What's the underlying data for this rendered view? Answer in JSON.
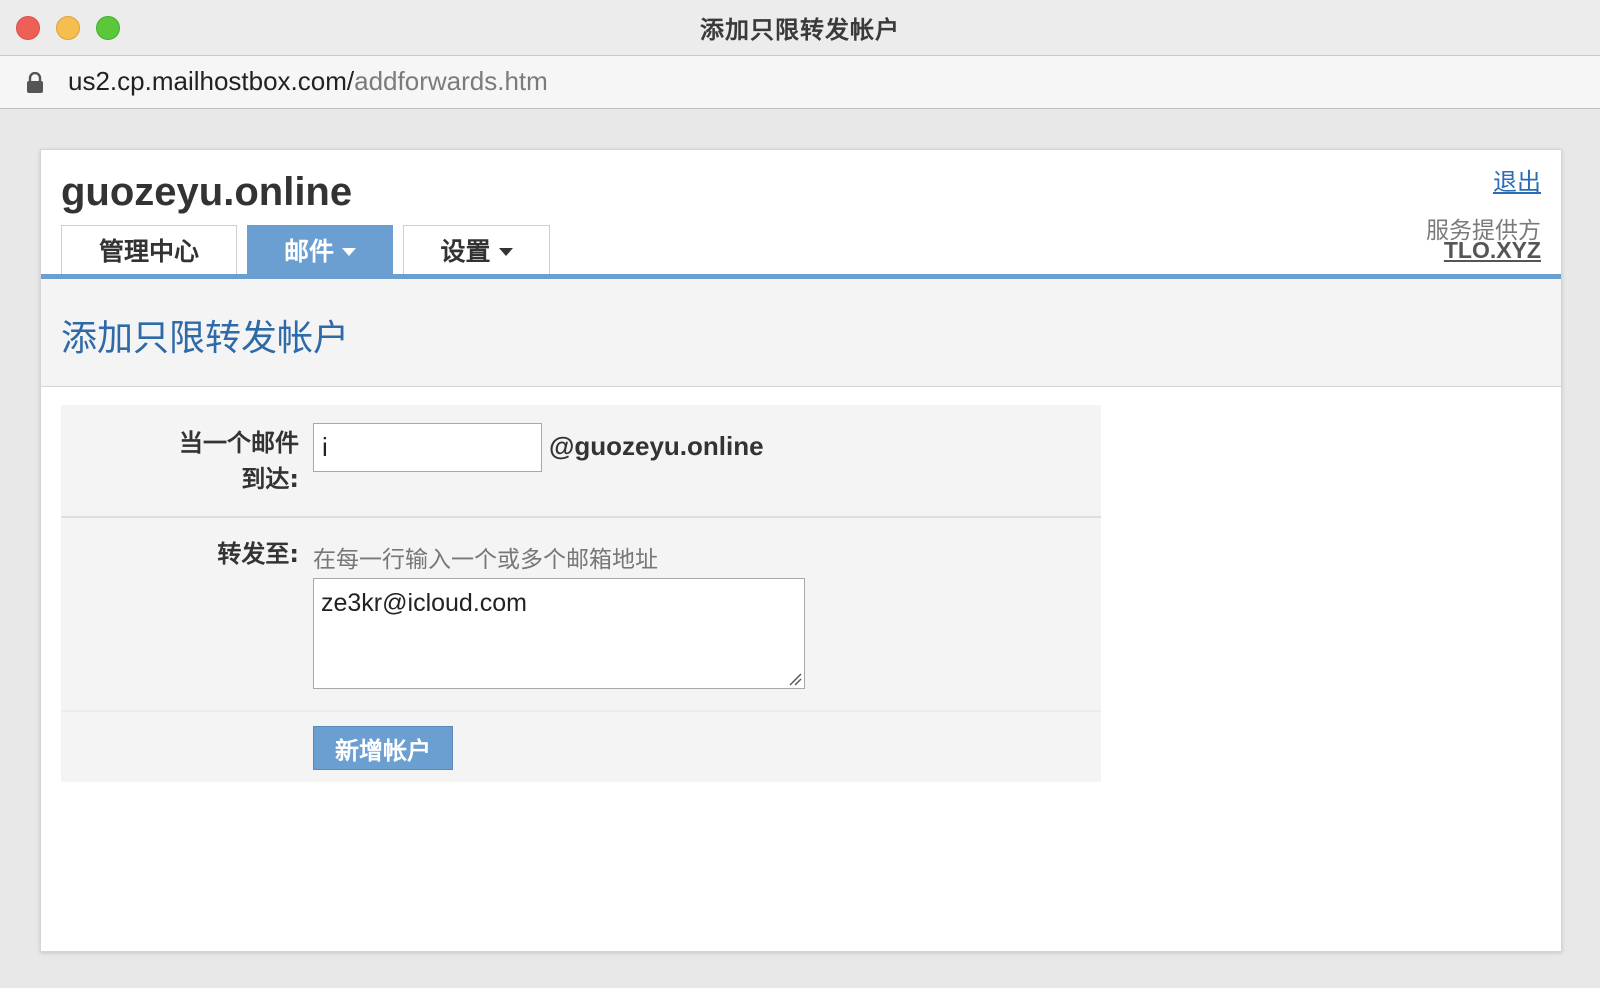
{
  "window": {
    "title": "添加只限转发帐户",
    "url_host": "us2.cp.mailhostbox.com/",
    "url_path": "addforwards.htm"
  },
  "header": {
    "domain": "guozeyu.online",
    "logout_label": "退出",
    "provider_label": "服务提供方",
    "provider_name": "TLO.XYZ"
  },
  "tabs": [
    {
      "label": "管理中心",
      "active": false,
      "has_dropdown": false
    },
    {
      "label": "邮件",
      "active": true,
      "has_dropdown": true
    },
    {
      "label": "设置",
      "active": false,
      "has_dropdown": true
    }
  ],
  "page": {
    "title": "添加只限转发帐户"
  },
  "form": {
    "arrive_label_line1": "当一个邮件",
    "arrive_label_line2": "到达:",
    "account_value": "i",
    "domain_suffix": "@guozeyu.online",
    "forward_label": "转发至:",
    "forward_hint": "在每一行输入一个或多个邮箱地址",
    "forward_value": "ze3kr@icloud.com",
    "submit_label": "新增帐户"
  },
  "colors": {
    "accent": "#6b9ed1",
    "title_blue": "#2e6aa8",
    "link_blue": "#2a6db5"
  }
}
